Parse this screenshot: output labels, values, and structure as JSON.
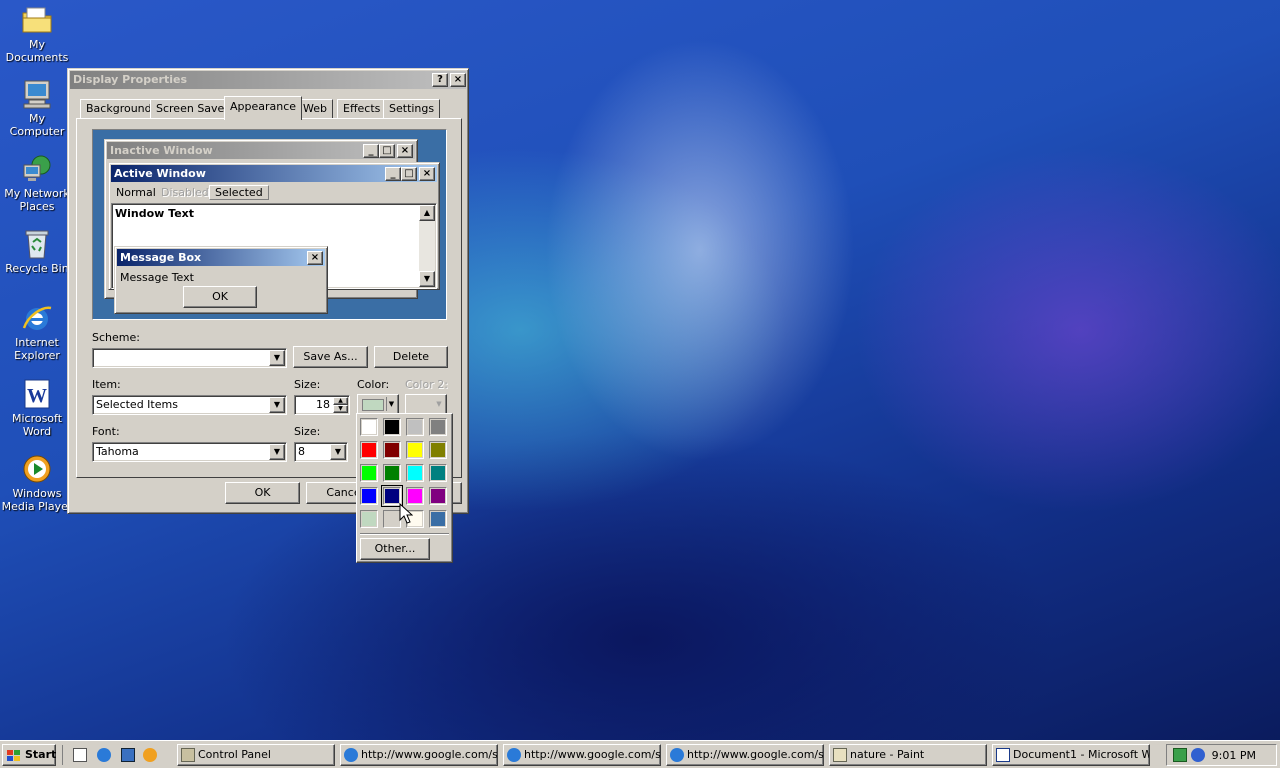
{
  "desktop": {
    "icons": [
      {
        "label": "My Documents"
      },
      {
        "label": "My Computer"
      },
      {
        "label": "My Network Places"
      },
      {
        "label": "Recycle Bin"
      },
      {
        "label": "Internet Explorer"
      },
      {
        "label": "Microsoft Word"
      },
      {
        "label": "Windows Media Player"
      }
    ]
  },
  "dialog": {
    "title": "Display Properties",
    "help_label": "?",
    "close_label": "×",
    "tabs": [
      "Background",
      "Screen Saver",
      "Appearance",
      "Web",
      "Effects",
      "Settings"
    ],
    "active_tab": "Appearance",
    "preview": {
      "inactive_title": "Inactive Window",
      "active_title": "Active Window",
      "menu": [
        "Normal",
        "Disabled",
        "Selected"
      ],
      "window_text": "Window Text",
      "message_title": "Message Box",
      "message_text": "Message Text",
      "message_ok": "OK"
    },
    "scheme_label": "Scheme:",
    "scheme_value": "",
    "save_as_label": "Save As...",
    "delete_label": "Delete",
    "item_label": "Item:",
    "item_value": "Selected Items",
    "size_label": "Size:",
    "size_value": "18",
    "color_label": "Color:",
    "color2_label": "Color 2:",
    "font_label": "Font:",
    "font_value": "Tahoma",
    "font_size_label": "Size:",
    "font_size_value": "8",
    "ok_label": "OK",
    "cancel_label": "Cance"
  },
  "color_picker": {
    "selected_color": "#c0d8c0",
    "colors": [
      "#ffffff",
      "#000000",
      "#c0c0c0",
      "#808080",
      "#ff0000",
      "#800000",
      "#ffff00",
      "#808000",
      "#00ff00",
      "#008000",
      "#00ffff",
      "#008080",
      "#0000ff",
      "#000080",
      "#ff00ff",
      "#800080",
      "#c0d8c0",
      "#d4d0c8",
      "#fffbf0",
      "#3a6ea5"
    ],
    "other_label": "Other..."
  },
  "taskbar": {
    "start_label": "Start",
    "buttons": [
      {
        "label": "Control Panel"
      },
      {
        "label": "http://www.google.com/s..."
      },
      {
        "label": "http://www.google.com/s..."
      },
      {
        "label": "http://www.google.com/s..."
      },
      {
        "label": "nature - Paint"
      },
      {
        "label": "Document1 - Microsoft W..."
      }
    ],
    "clock": "9:01 PM"
  },
  "colors": {
    "title_active_start": "#0a246a",
    "title_active_end": "#a6caf0",
    "title_inactive_start": "#808080",
    "title_inactive_end": "#c0c0c0",
    "preview_desktop": "#3a6ea5",
    "face": "#d4d0c8"
  }
}
